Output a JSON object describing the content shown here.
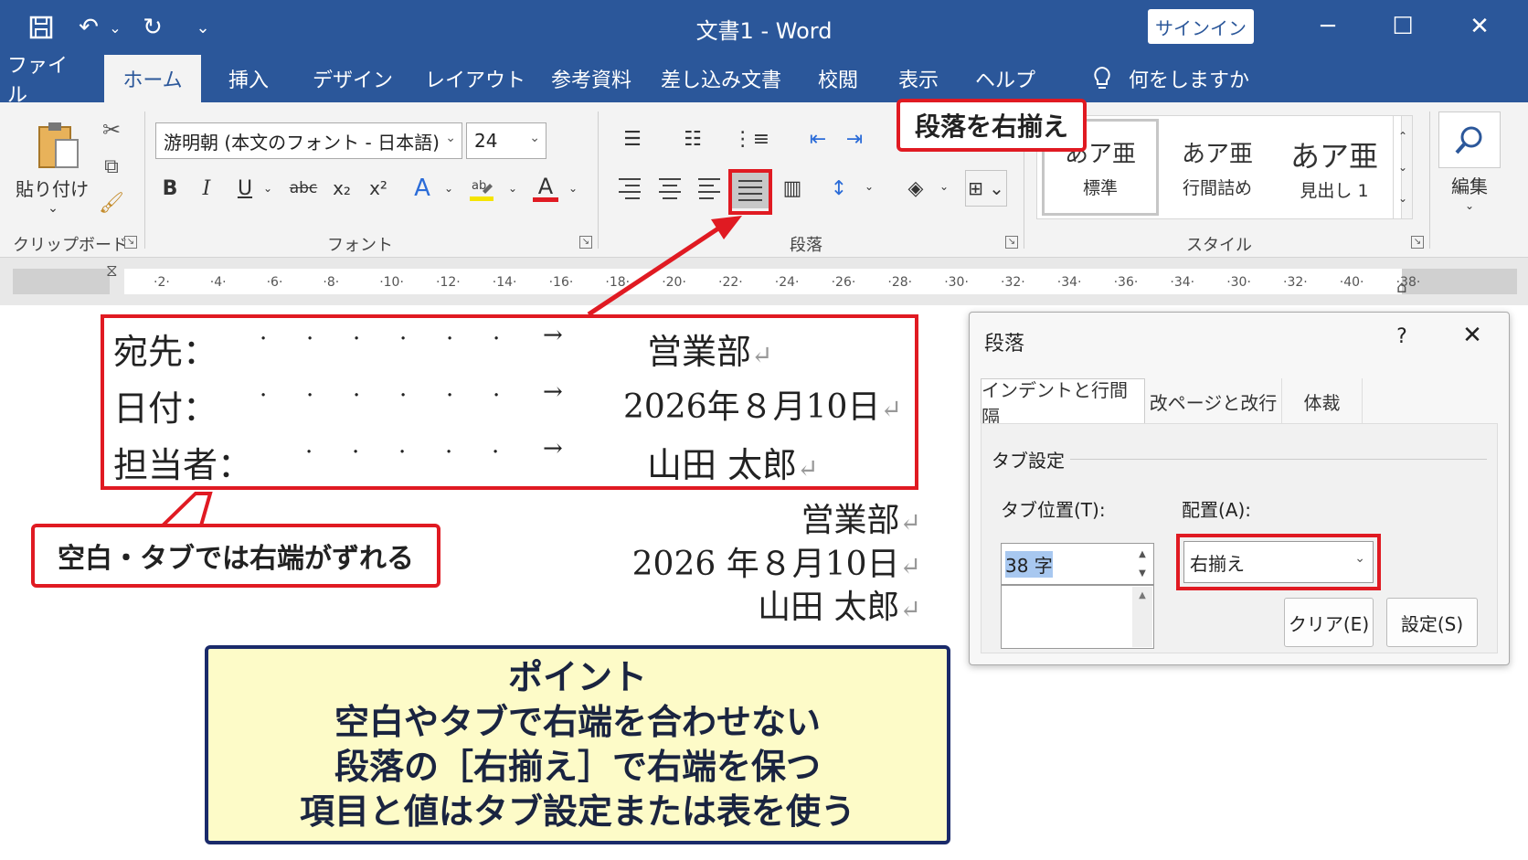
{
  "window": {
    "title": "文書1  -  Word",
    "signin": "サインイン",
    "qat": [
      "save-icon",
      "undo-icon",
      "redo-icon",
      "customize-icon"
    ]
  },
  "tabs": [
    "ファイル",
    "ホーム",
    "挿入",
    "デザイン",
    "レイアウト",
    "参考資料",
    "差し込み文書",
    "校閲",
    "表示",
    "ヘルプ"
  ],
  "tellme": "何をしますか",
  "ribbon": {
    "clipboard": {
      "paste": "貼り付け",
      "label": "クリップボード"
    },
    "font": {
      "name": "游明朝 (本文のフォント - 日本語)",
      "size": "24",
      "label": "フォント",
      "bold": "B",
      "italic": "I",
      "underline": "U",
      "strike": "abc",
      "sub": "x₂",
      "sup": "x²",
      "effects": "A",
      "color": "A"
    },
    "paragraph": {
      "label": "段落"
    },
    "styles": {
      "label": "スタイル",
      "items": [
        {
          "sample": "あア亜",
          "name": "標準"
        },
        {
          "sample": "あア亜",
          "name": "行間詰め"
        },
        {
          "sample": "あア亜",
          "name": "見出し 1"
        }
      ]
    },
    "editing": {
      "label": "編集"
    }
  },
  "ruler": [
    "2",
    "4",
    "6",
    "8",
    "10",
    "12",
    "14",
    "16",
    "18",
    "20",
    "22",
    "24",
    "26",
    "28",
    "30",
    "32",
    "34",
    "36",
    "34",
    "30",
    "32",
    "40",
    "38"
  ],
  "callout": "段落を右揃え",
  "document": {
    "tab_lines": [
      {
        "label": "宛先：",
        "value": "営業部"
      },
      {
        "label": "日付：",
        "value": "2026年８月10日"
      },
      {
        "label": "担当者：",
        "value": "山田 太郎"
      }
    ],
    "right_lines": [
      "営業部",
      "2026 年８月10日",
      "山田 太郎"
    ],
    "note": "空白・タブでは右端がずれる"
  },
  "point": {
    "title": "ポイント",
    "lines": [
      "空白やタブで右端を合わせない",
      "段落の［右揃え］で右端を保つ",
      "項目と値はタブ設定または表を使う"
    ]
  },
  "dialog": {
    "title": "段落",
    "help": "?",
    "tabs": [
      "インデントと行間隔",
      "改ページと改行",
      "体裁"
    ],
    "section": "タブ設定",
    "tab_pos_label": "タブ位置(T):",
    "tab_pos_value": "38 字",
    "align_label": "配置(A):",
    "align_value": "右揃え",
    "clear": "クリア(E)",
    "set": "設定(S)"
  }
}
